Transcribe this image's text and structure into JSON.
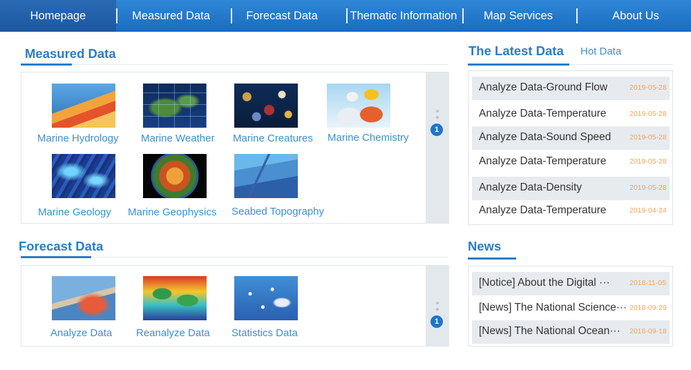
{
  "nav": {
    "items": [
      {
        "label": "Homepage",
        "active": true
      },
      {
        "label": "Measured Data"
      },
      {
        "label": "Forecast Data"
      },
      {
        "label": "Thematic Information"
      },
      {
        "label": "Map Services"
      },
      {
        "label": "About Us"
      }
    ]
  },
  "measured": {
    "title": "Measured Data",
    "page_badge": "1",
    "tiles": [
      {
        "label": "Marine Hydrology",
        "icon": "ocean-cross-section-image"
      },
      {
        "label": "Marine Weather",
        "icon": "weather-satellite-map-image"
      },
      {
        "label": "Marine Creatures",
        "icon": "coral-reef-fish-image"
      },
      {
        "label": "Marine Chemistry",
        "icon": "scientists-sampling-image"
      },
      {
        "label": "Marine Geology",
        "icon": "seafloor-relief-map-image"
      },
      {
        "label": "Marine Geophysics",
        "icon": "earth-core-globe-image"
      },
      {
        "label": "Seabed Topography",
        "icon": "seabed-terrain-image"
      }
    ]
  },
  "forecast": {
    "title": "Forecast Data",
    "page_badge": "1",
    "tiles": [
      {
        "label": "Analyze Data",
        "icon": "coastal-current-image"
      },
      {
        "label": "Reanalyze Data",
        "icon": "global-temperature-map-image"
      },
      {
        "label": "Statistics Data",
        "icon": "ocean-satellite-image"
      }
    ]
  },
  "latest": {
    "tab_active": "The Latest Data",
    "tab_inactive": "Hot Data",
    "rows": [
      {
        "text": "Analyze Data-Ground Flow",
        "date": "2019-05-28"
      },
      {
        "text": "Analyze Data-Temperature",
        "date": "2019-05-28"
      },
      {
        "text": "Analyze Data-Sound Speed",
        "date": "2019-05-28"
      },
      {
        "text": "Analyze Data-Temperature",
        "date": "2019-05-28"
      },
      {
        "text": "Analyze Data-Density",
        "date": "2019-05-28"
      },
      {
        "text": "Analyze Data-Temperature",
        "date": "2019-04-24"
      }
    ]
  },
  "news": {
    "title": "News",
    "rows": [
      {
        "text": "[Notice] About the Digital ···",
        "date": "2018-11-05"
      },
      {
        "text": "[News] The National Science···",
        "date": "2018-09-29"
      },
      {
        "text": "[News] The National Ocean···",
        "date": "2018-09-18"
      }
    ]
  },
  "colors": {
    "nav_bg": "#1a6cc0",
    "accent": "#2a7cc7",
    "tile_label": "#3a8fd3",
    "date": "#f2a55a",
    "row_shade": "#e7ebef"
  }
}
